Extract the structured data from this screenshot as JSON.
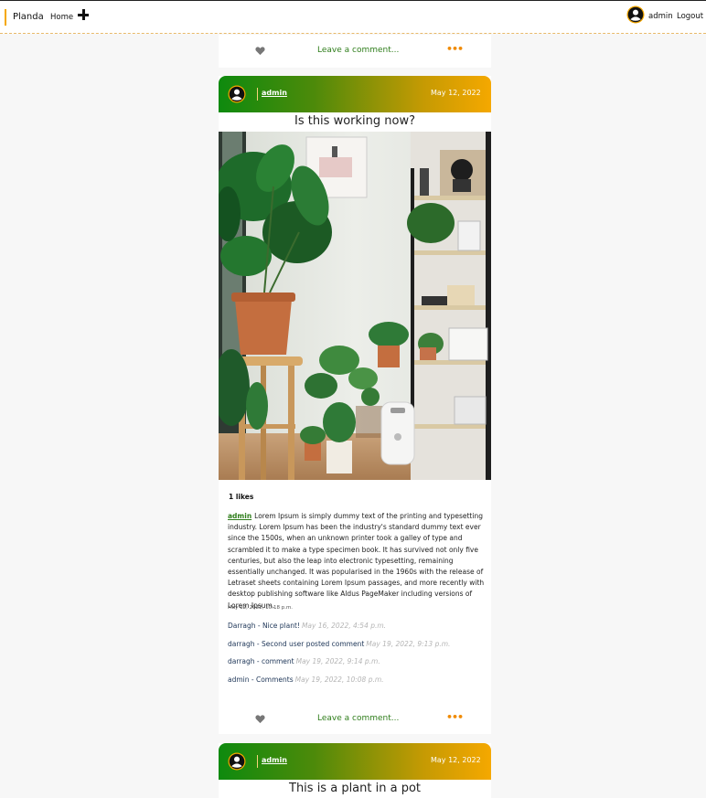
{
  "nav": {
    "brand": "Planda",
    "home": "Home",
    "add_icon": "plus-icon",
    "avatar_icon": "user-avatar-icon",
    "username": "admin",
    "logout": "Logout"
  },
  "colors": {
    "accent_orange": "#f5a800",
    "header_green": "#0e8a0e",
    "link_green": "#2e7d1a"
  },
  "actions": {
    "leave_comment": "Leave a comment...",
    "like_icon": "heart-icon",
    "more_icon": "more-dots-icon",
    "more_glyph": "•••"
  },
  "posts": [
    {
      "author": "admin",
      "date": "May 12, 2022",
      "title": "Is this working now?",
      "likes": "1 likes",
      "caption_user": "admin",
      "caption": "Lorem Ipsum is simply dummy text of the printing and typesetting industry. Lorem Ipsum has been the industry's standard dummy text ever since the 1500s, when an unknown printer took a galley of type and scrambled it to make a type specimen book. It has survived not only five centuries, but also the leap into electronic typesetting, remaining essentially unchanged. It was popularised in the 1960s with the release of Letraset sheets containing Lorem Ipsum passages, and more recently with desktop publishing software like Aldus PageMaker including versions of Lorem Ipsum.",
      "timestamp": "May 12, 2022, 10:18 p.m.",
      "comments": [
        {
          "text": "Darragh - Nice plant!",
          "time": "May 16, 2022, 4:54 p.m."
        },
        {
          "text": "darragh - Second user posted comment",
          "time": "May 19, 2022, 9:13 p.m."
        },
        {
          "text": "darragh - comment",
          "time": "May 19, 2022, 9:14 p.m."
        },
        {
          "text": "admin - Comments",
          "time": "May 19, 2022, 10:08 p.m."
        }
      ]
    },
    {
      "author": "admin",
      "date": "May 12, 2022",
      "title": "This is a plant in a pot"
    }
  ]
}
